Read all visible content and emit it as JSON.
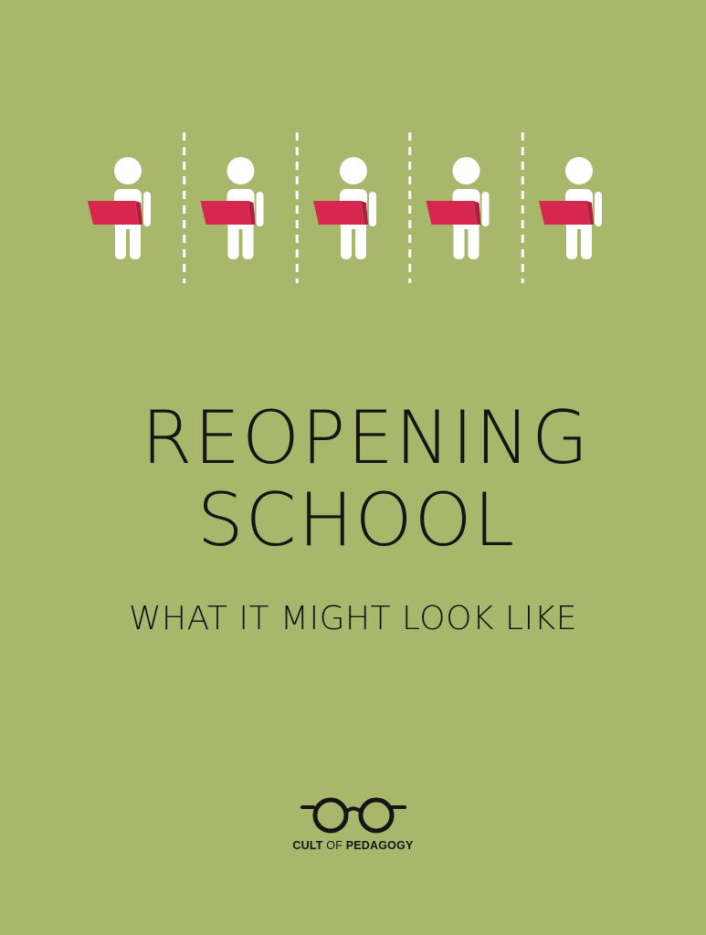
{
  "title": {
    "line1": "REOPENING",
    "line2": "SCHOOL"
  },
  "subtitle": "WHAT IT MIGHT LOOK LIKE",
  "brand": {
    "part1": "CULT",
    "part2": " OF ",
    "part3": "PEDAGOGY"
  },
  "illustration": {
    "figure_count": 5,
    "divider_count": 4,
    "icon": "student-with-laptop-icon"
  },
  "colors": {
    "background": "#a8b76c",
    "figure": "#ffffff",
    "laptop": "#d6284f",
    "text": "#151515"
  }
}
